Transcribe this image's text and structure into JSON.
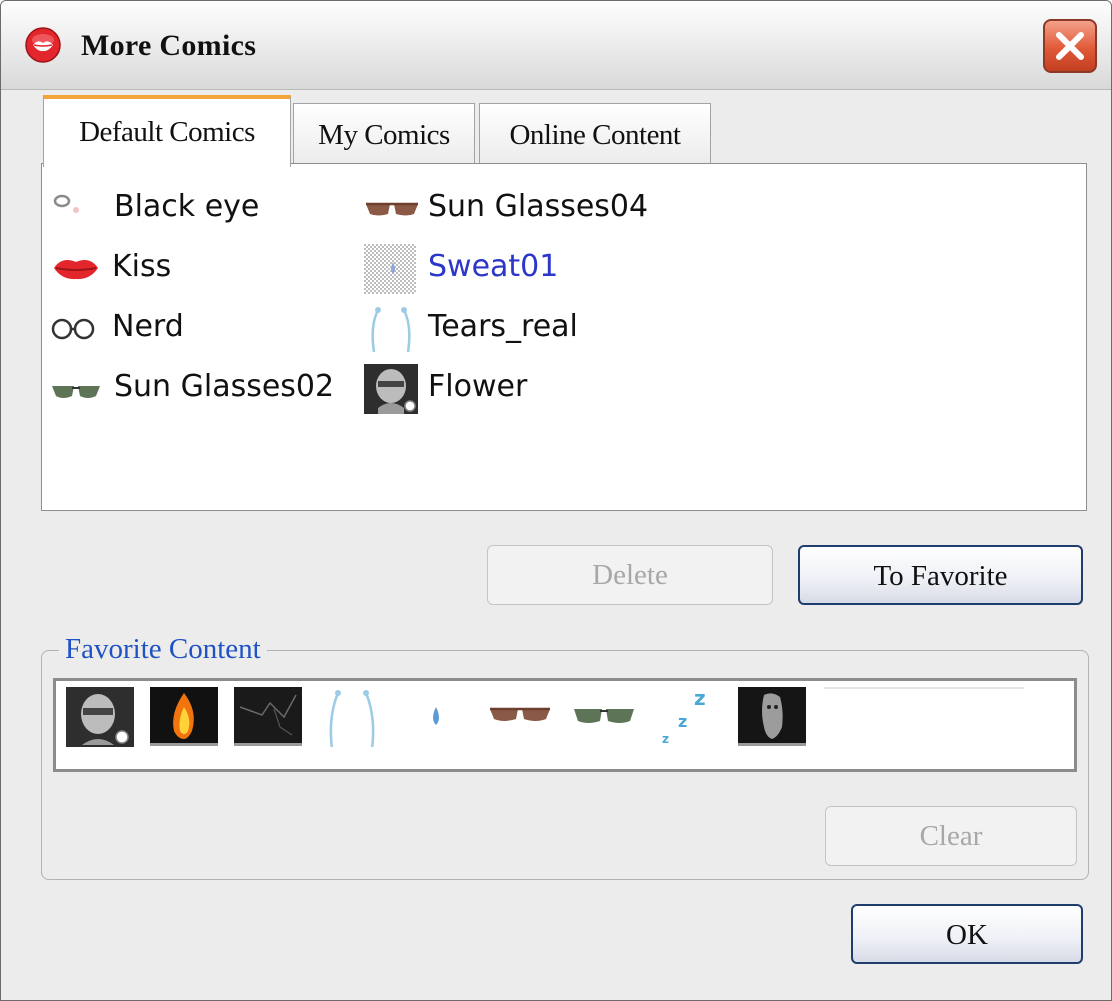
{
  "window": {
    "title": "More Comics"
  },
  "tabs": [
    {
      "label": "Default Comics",
      "active": true
    },
    {
      "label": "My Comics",
      "active": false
    },
    {
      "label": "Online Content",
      "active": false
    }
  ],
  "comics": {
    "column1": [
      {
        "label": "Black eye",
        "icon": "black-eye-icon"
      },
      {
        "label": "Kiss",
        "icon": "kiss-lips-icon"
      },
      {
        "label": "Nerd",
        "icon": "nerd-glasses-icon"
      },
      {
        "label": "Sun Glasses02",
        "icon": "sunglasses-icon"
      }
    ],
    "column2": [
      {
        "label": "Sun Glasses04",
        "icon": "sunglasses-icon"
      },
      {
        "label": "Sweat01",
        "icon": "sweat-drop-icon",
        "selected": true
      },
      {
        "label": "Tears_real",
        "icon": "tears-icon"
      },
      {
        "label": "Flower",
        "icon": "head-thumbnail-icon"
      }
    ]
  },
  "buttons": {
    "delete": "Delete",
    "to_favorite": "To Favorite",
    "clear": "Clear",
    "ok": "OK"
  },
  "favorites": {
    "title": "Favorite Content",
    "items": [
      "head-thumbnail-icon",
      "fire-icon",
      "lightning-icon",
      "tears-icon",
      "sweat-drop-icon",
      "sunglasses-icon",
      "sunglasses-icon",
      "zzz-sleep-icon",
      "ghost-icon"
    ]
  },
  "colors": {
    "selected_text": "#2c36c8",
    "legend_text": "#1f52c5",
    "active_tab_accent": "#f3a53a",
    "close_button": "#e05a39"
  }
}
